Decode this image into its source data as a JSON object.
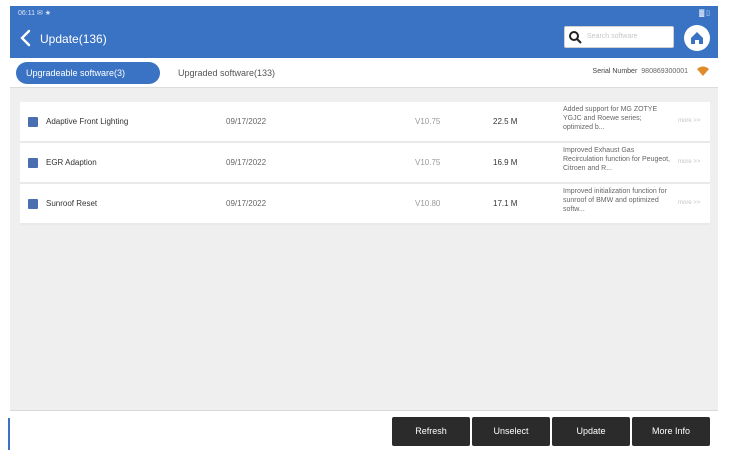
{
  "statusbar": {
    "time": "06:11 ✉ ★",
    "indicators": "▓ ▯"
  },
  "header": {
    "title": "Update(136)",
    "search_placeholder": "Search software"
  },
  "tabs": [
    {
      "label": "Upgradeable software(3)"
    },
    {
      "label": "Upgraded software(133)"
    }
  ],
  "serial": {
    "label": "Serial Number",
    "value": "980869300001"
  },
  "rows": [
    {
      "name": "Adaptive Front Lighting",
      "date": "09/17/2022",
      "version": "V10.75",
      "size": "22.5 M",
      "desc": "Added support for MG ZOTYE YGJC and Roewe series; optimized b...",
      "more": "more >>"
    },
    {
      "name": "EGR Adaption",
      "date": "09/17/2022",
      "version": "V10.75",
      "size": "16.9 M",
      "desc": "Improved Exhaust Gas Recirculation function for Peugeot, Citroen and R...",
      "more": "more >>"
    },
    {
      "name": "Sunroof Reset",
      "date": "09/17/2022",
      "version": "V10.80",
      "size": "17.1 M",
      "desc": "Improved initialization function for sunroof of BMW and optimized softw...",
      "more": "more >>"
    }
  ],
  "footer": {
    "refresh": "Refresh",
    "unselect": "Unselect",
    "update": "Update",
    "more": "More Info"
  }
}
